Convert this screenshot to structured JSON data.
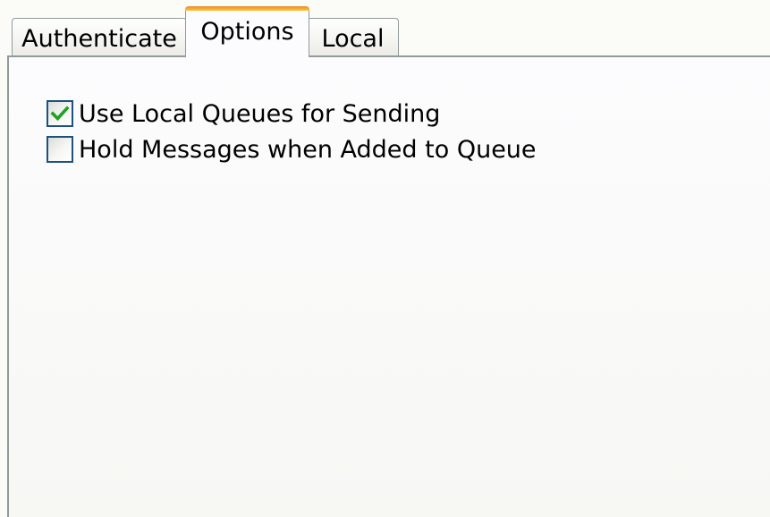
{
  "tabs": [
    {
      "label": "Authenticate",
      "selected": false
    },
    {
      "label": "Options",
      "selected": true
    },
    {
      "label": "Local",
      "selected": false
    }
  ],
  "options": [
    {
      "label": "Use Local Queues for Sending",
      "checked": true,
      "icon": "checkmark-icon"
    },
    {
      "label": "Hold Messages when Added to Queue",
      "checked": false
    }
  ],
  "colors": {
    "accent": "#f8b33a",
    "border": "#919b9c",
    "checkbox_border": "#1c5180",
    "check": "#21a121"
  }
}
